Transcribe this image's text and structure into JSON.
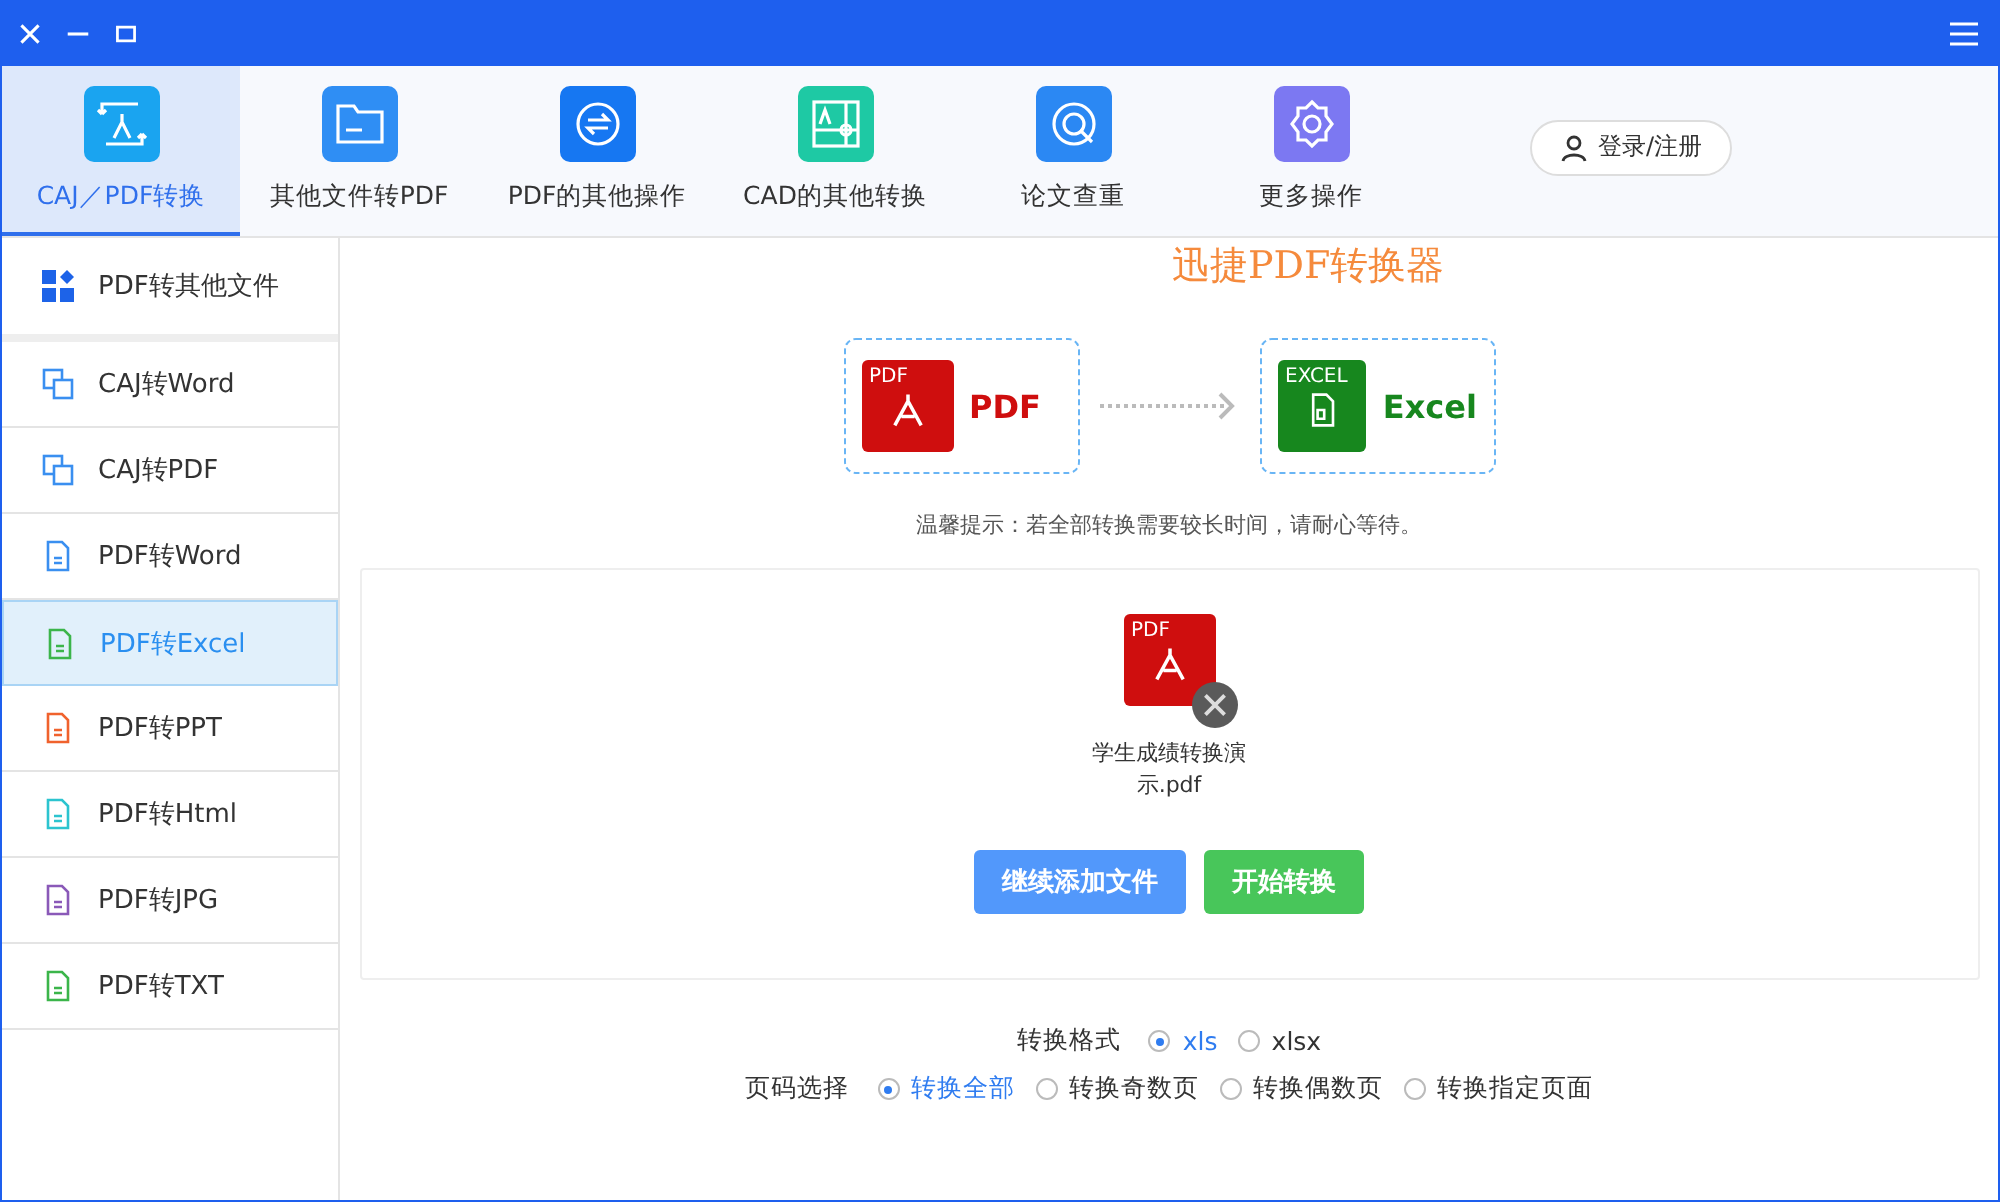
{
  "tabs": [
    {
      "label": "CAJ／PDF转换",
      "selected": true,
      "color": "#1aa4f0"
    },
    {
      "label": "其他文件转PDF",
      "selected": false,
      "color": "#2f8ef4"
    },
    {
      "label": "PDF的其他操作",
      "selected": false,
      "color": "#1677f2"
    },
    {
      "label": "CAD的其他转换",
      "selected": false,
      "color": "#1ec9a4"
    },
    {
      "label": "论文查重",
      "selected": false,
      "color": "#2b88f3"
    },
    {
      "label": "更多操作",
      "selected": false,
      "color": "#7c78f2"
    }
  ],
  "login_button": "登录/注册",
  "annotation": "迅捷PDF转换器",
  "sidebar": {
    "items": [
      {
        "label": "PDF转其他文件",
        "selected": false,
        "color": "#1d63e8",
        "kind": "grid"
      },
      {
        "label": "CAJ转Word",
        "selected": false,
        "color": "#3a8ff0",
        "kind": "doc"
      },
      {
        "label": "CAJ转PDF",
        "selected": false,
        "color": "#3a8ff0",
        "kind": "doc"
      },
      {
        "label": "PDF转Word",
        "selected": false,
        "color": "#3a8ff0",
        "kind": "file"
      },
      {
        "label": "PDF转Excel",
        "selected": true,
        "color": "#3bb54a",
        "kind": "file"
      },
      {
        "label": "PDF转PPT",
        "selected": false,
        "color": "#f0622d",
        "kind": "file"
      },
      {
        "label": "PDF转Html",
        "selected": false,
        "color": "#2cc4cf",
        "kind": "file"
      },
      {
        "label": "PDF转JPG",
        "selected": false,
        "color": "#8a59b8",
        "kind": "file"
      },
      {
        "label": "PDF转TXT",
        "selected": false,
        "color": "#3bb54a",
        "kind": "file"
      }
    ]
  },
  "conversion": {
    "source": {
      "icon_text": "PDF",
      "label": "PDF"
    },
    "target": {
      "icon_text": "EXCEL",
      "label": "Excel"
    }
  },
  "hint": "温馨提示：若全部转换需要较长时间，请耐心等待。",
  "file": {
    "icon_text": "PDF",
    "name": "学生成绩转换演示.pdf"
  },
  "buttons": [
    {
      "label": "继续添加文件",
      "kind": "secondary"
    },
    {
      "label": "开始转换",
      "kind": "primary"
    }
  ],
  "format": {
    "label": "转换格式",
    "options": [
      {
        "label": "xls",
        "selected": true
      },
      {
        "label": "xlsx",
        "selected": false
      }
    ]
  },
  "pages": {
    "label": "页码选择",
    "options": [
      {
        "label": "转换全部",
        "selected": true
      },
      {
        "label": "转换奇数页",
        "selected": false
      },
      {
        "label": "转换偶数页",
        "selected": false
      },
      {
        "label": "转换指定页面",
        "selected": false
      }
    ]
  }
}
